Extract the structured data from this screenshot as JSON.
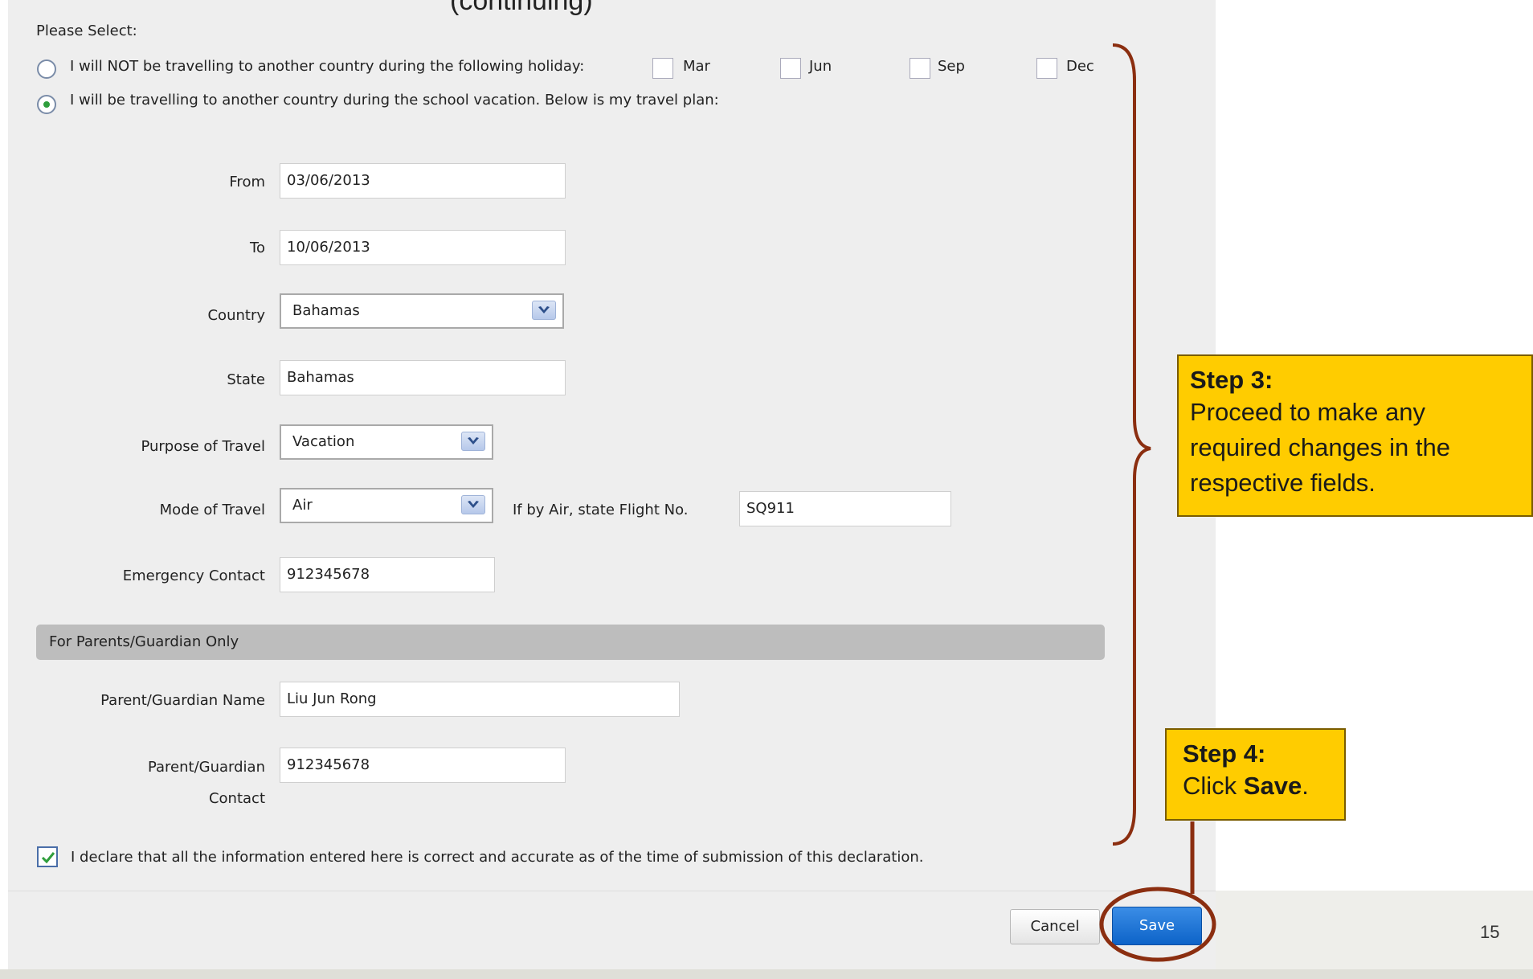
{
  "partial_title": "(continuing)",
  "instructions": "Please Select:",
  "options": {
    "not_travelling": "I will NOT be travelling to another country during the following holiday:",
    "travelling": "I will be travelling to another country during the school vacation. Below is my travel plan:"
  },
  "months": [
    "Mar",
    "Jun",
    "Sep",
    "Dec"
  ],
  "fields": {
    "from_label": "From",
    "from_value": "03/06/2013",
    "to_label": "To",
    "to_value": "10/06/2013",
    "country_label": "Country",
    "country_value": "Bahamas",
    "state_label": "State",
    "state_value": "Bahamas",
    "purpose_label": "Purpose of Travel",
    "purpose_value": "Vacation",
    "mode_label": "Mode of Travel",
    "mode_value": "Air",
    "flight_label": "If by Air, state Flight No.",
    "flight_value": "SQ911",
    "emergency_label": "Emergency Contact",
    "emergency_value": "912345678"
  },
  "section_parents": "For Parents/Guardian Only",
  "parent": {
    "name_label": "Parent/Guardian Name",
    "name_value": "Liu Jun Rong",
    "contact_label_1": "Parent/Guardian",
    "contact_label_2": "Contact",
    "contact_value": "912345678"
  },
  "declaration": "I declare that all the information entered here is correct and accurate as of the time of submission of this declaration.",
  "buttons": {
    "cancel": "Cancel",
    "save": "Save"
  },
  "callouts": {
    "step3_title": "Step 3:",
    "step3_text": "Proceed to make any required changes in the respective fields.",
    "step4_title": "Step 4:",
    "step4_text_pre": "Click ",
    "step4_text_bold": "Save",
    "step4_text_post": "."
  },
  "page_number": "15",
  "colors": {
    "callout": "#ffcc00",
    "bracket": "#8b2e10",
    "save_button": "#0d63c8",
    "radio_selected": "#2f9e3c"
  }
}
